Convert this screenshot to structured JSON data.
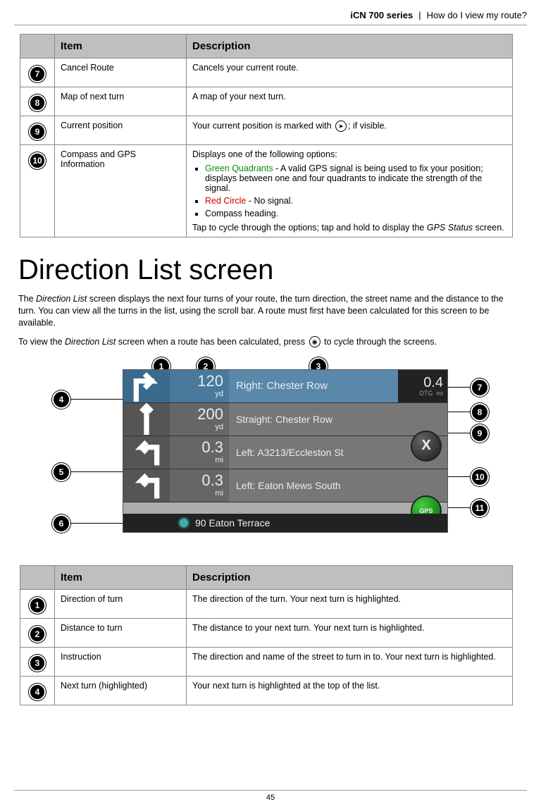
{
  "header": {
    "series": "iCN 700 series",
    "sep": "|",
    "question": "How do I view my route?"
  },
  "footer": {
    "page": "45"
  },
  "table1": {
    "headers": {
      "item": "Item",
      "desc": "Description"
    },
    "rows": [
      {
        "n": "7",
        "item": "Cancel Route",
        "desc": "Cancels your current route."
      },
      {
        "n": "8",
        "item": "Map of next turn",
        "desc": "A map of your next turn."
      },
      {
        "n": "9",
        "item": "Current position",
        "desc_prefix": "Your current position is marked with ",
        "desc_suffix": "; if visible."
      },
      {
        "n": "10",
        "item": "Compass and GPS Information",
        "intro": "Displays one of the following options:",
        "bullets": [
          {
            "highlight": "Green Quadrants",
            "cls": "green",
            "rest": " - A valid GPS signal is being used to fix your position; displays between one and four quadrants to indicate the strength of the signal."
          },
          {
            "highlight": "Red Circle",
            "cls": "red",
            "rest": " - No signal."
          },
          {
            "highlight": "",
            "cls": "",
            "rest": "Compass heading."
          }
        ],
        "outro_a": "Tap to cycle through the options; tap and hold to display the ",
        "outro_em": "GPS Status",
        "outro_b": " screen."
      }
    ]
  },
  "heading": "Direction List screen",
  "para1_a": "The ",
  "para1_em": "Direction List",
  "para1_b": " screen displays the next four turns of your route, the turn direction, the street name and the distance to the turn. You can view all the turns in the list, using the scroll bar. A route must first have been calculated for this screen to be available.",
  "para2_a": "To view the ",
  "para2_em": "Direction List",
  "para2_b": " screen when a route has been calculated, press ",
  "para2_c": " to cycle through the screens.",
  "device": {
    "dtg_val": "0.4",
    "dtg_label": "DTG",
    "dtg_unit": "mi",
    "rows": [
      {
        "dist": "120",
        "unit": "yd",
        "instr": "Right: Chester Row"
      },
      {
        "dist": "200",
        "unit": "yd",
        "instr": "Straight: Chester Row"
      },
      {
        "dist": "0.3",
        "unit": "mi",
        "instr": "Left: A3213/Eccleston St"
      },
      {
        "dist": "0.3",
        "unit": "mi",
        "instr": "Left: Eaton Mews South"
      }
    ],
    "bottom": "90 Eaton Terrace",
    "gps": "GPS"
  },
  "callouts_top": [
    "1",
    "2",
    "3"
  ],
  "callouts_left": [
    "4",
    "5",
    "6"
  ],
  "callouts_right": [
    "7",
    "8",
    "9",
    "10",
    "11"
  ],
  "table2": {
    "headers": {
      "item": "Item",
      "desc": "Description"
    },
    "rows": [
      {
        "n": "1",
        "item": "Direction of turn",
        "desc": "The direction of the turn. Your next turn is highlighted."
      },
      {
        "n": "2",
        "item": "Distance to turn",
        "desc": "The distance to your next turn. Your next turn is highlighted."
      },
      {
        "n": "3",
        "item": "Instruction",
        "desc": "The direction and name of the street to turn in to. Your next turn is highlighted."
      },
      {
        "n": "4",
        "item": "Next turn (highlighted)",
        "desc": "Your next turn is highlighted at the top of the list."
      }
    ]
  }
}
